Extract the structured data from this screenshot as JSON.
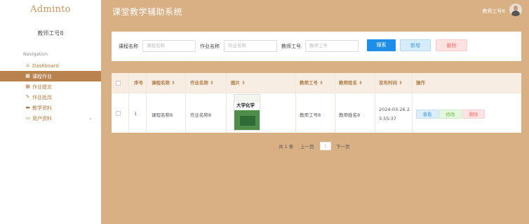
{
  "app": {
    "logo": "Adminto",
    "title": "课堂教学辅助系统"
  },
  "sidebar": {
    "user": "教师工号8",
    "nav_label": "Navigation",
    "items": [
      {
        "label": "Dashboard",
        "icon": "home-icon"
      },
      {
        "label": "课程作业",
        "icon": "grid-icon",
        "active": true
      },
      {
        "label": "作业提交",
        "icon": "grid-icon"
      },
      {
        "label": "作业批改",
        "icon": "edit-icon"
      },
      {
        "label": "教学资料",
        "icon": "briefcase-icon"
      },
      {
        "label": "用户资料",
        "icon": "folder-icon",
        "expandable": true
      }
    ]
  },
  "header": {
    "user": "教师工号8"
  },
  "search": {
    "course_label": "课程名称",
    "course_placeholder": "课程名称",
    "homework_label": "作业名称",
    "homework_placeholder": "作业名称",
    "teacher_label": "教师工号",
    "teacher_placeholder": "教师工号",
    "search_btn": "搜索",
    "add_btn": "新增",
    "delete_btn": "删除"
  },
  "table": {
    "headers": {
      "index": "序号",
      "course": "课程名称 ⇕",
      "homework": "作业名称 ⇕",
      "image": "图片 ⇕",
      "teacher_id": "教师工号 ⇕",
      "teacher_name": "教师姓名 ⇕",
      "publish_time": "发布时间 ⇕",
      "actions": "操作"
    },
    "rows": [
      {
        "index": "1",
        "course": "课程名称8",
        "homework": "作业名称8",
        "image_title": "大学化学",
        "teacher_id": "教师工号8",
        "teacher_name": "教师姓名8",
        "publish_date": "2024-03-26 2",
        "publish_time": "3:55:37",
        "view": "查看",
        "edit": "修改",
        "delete": "删除"
      }
    ]
  },
  "pagination": {
    "total": "共 1 条",
    "prev": "上一页",
    "page": "1",
    "next": "下一页"
  },
  "colors": {
    "background": "#d8b084",
    "accent": "#b8824e",
    "primary": "#1f8ee8"
  }
}
